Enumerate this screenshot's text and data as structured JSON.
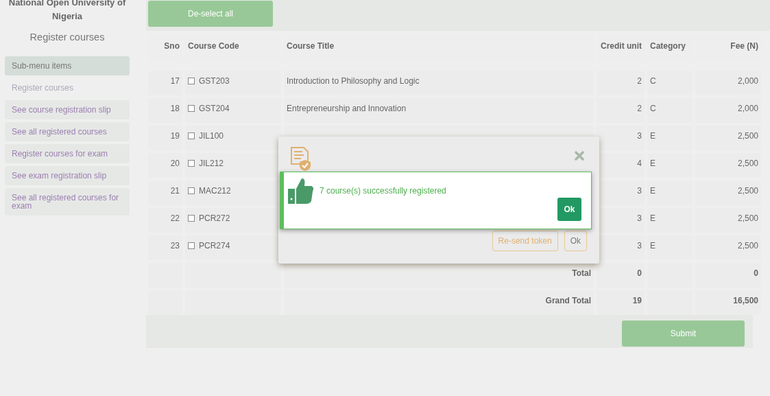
{
  "sidebar": {
    "university": "National Open University of Nigeria",
    "heading": "Register courses",
    "items": [
      {
        "label": "Sub-menu items",
        "kind": "header"
      },
      {
        "label": "Register courses",
        "kind": "link",
        "selected": true
      },
      {
        "label": "See course registration slip",
        "kind": "link",
        "selected": false
      },
      {
        "label": "See all registered courses",
        "kind": "link",
        "selected": false
      },
      {
        "label": "Register courses for exam",
        "kind": "link",
        "selected": false
      },
      {
        "label": "See exam registration slip",
        "kind": "link",
        "selected": false
      },
      {
        "label": "See all registered courses for exam",
        "kind": "link",
        "selected": false
      }
    ]
  },
  "deselect_button": "De-select all",
  "table": {
    "columns": [
      "Sno",
      "Course Code",
      "Course Title",
      "Credit unit",
      "Category",
      "Fee (N)"
    ],
    "rows": [
      {
        "sno": "17",
        "code": "GST203",
        "checked": false,
        "title": "Introduction to Philosophy and Logic",
        "credit": "2",
        "category": "C",
        "fee": "2,000"
      },
      {
        "sno": "18",
        "code": "GST204",
        "checked": false,
        "title": "Entrepreneurship and Innovation",
        "credit": "2",
        "category": "C",
        "fee": "2,000"
      },
      {
        "sno": "19",
        "code": "JIL100",
        "checked": false,
        "title": "",
        "credit": "3",
        "category": "E",
        "fee": "2,500"
      },
      {
        "sno": "20",
        "code": "JIL212",
        "checked": false,
        "title": "",
        "credit": "4",
        "category": "E",
        "fee": "2,500"
      },
      {
        "sno": "21",
        "code": "MAC212",
        "checked": false,
        "title": "",
        "credit": "3",
        "category": "E",
        "fee": "2,500"
      },
      {
        "sno": "22",
        "code": "PCR272",
        "checked": false,
        "title": "",
        "credit": "3",
        "category": "E",
        "fee": "2,500"
      },
      {
        "sno": "23",
        "code": "PCR274",
        "checked": false,
        "title": "",
        "credit": "3",
        "category": "E",
        "fee": "2,500"
      }
    ],
    "totals": [
      {
        "label": "Total",
        "credit": "0",
        "fee": "0"
      },
      {
        "label": "Grand Total",
        "credit": "19",
        "fee": "16,500"
      }
    ]
  },
  "submit_button": "Submit",
  "token_dialog": {
    "buttons": [
      "Re-send token",
      "Ok"
    ]
  },
  "success_alert": {
    "message": "7 course(s) successfully registered",
    "button": "Ok"
  }
}
